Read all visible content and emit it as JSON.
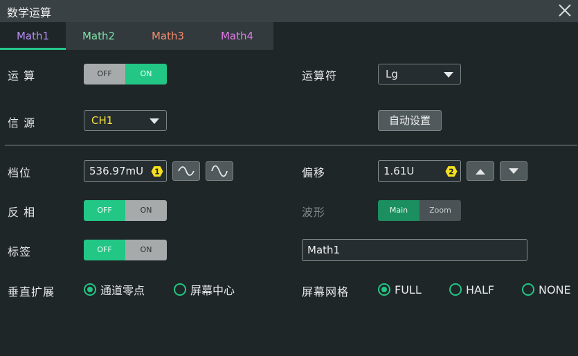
{
  "window": {
    "title": "数学运算"
  },
  "tabs": [
    {
      "label": "Math1",
      "color": "#b58cf2"
    },
    {
      "label": "Math2",
      "color": "#7ee0a8"
    },
    {
      "label": "Math3",
      "color": "#f28a6c"
    },
    {
      "label": "Math4",
      "color": "#e27ae6"
    }
  ],
  "operation": {
    "label": "运 算",
    "off": "OFF",
    "on": "ON",
    "state": "ON"
  },
  "operator": {
    "label": "运算符",
    "value": "Lg"
  },
  "source": {
    "label": "信 源",
    "value": "CH1",
    "value_color": "#f2e23a"
  },
  "auto_setup": {
    "label": "自动设置"
  },
  "scale": {
    "label": "档位",
    "value": "536.97mU",
    "knob": "1"
  },
  "offset": {
    "label": "偏移",
    "value": "1.61U",
    "knob": "2"
  },
  "invert": {
    "label": "反 相",
    "off": "OFF",
    "on": "ON",
    "state": "OFF"
  },
  "waveform": {
    "label": "波形",
    "main": "Main",
    "zoom": "Zoom",
    "state": "Main"
  },
  "tag": {
    "label": "标签",
    "off": "OFF",
    "on": "ON",
    "state": "OFF",
    "text": "Math1"
  },
  "vertical_expand": {
    "label": "垂直扩展",
    "options": [
      "通道零点",
      "屏幕中心"
    ],
    "selected": "通道零点"
  },
  "grid": {
    "label": "屏幕网格",
    "options": [
      "FULL",
      "HALF",
      "NONE"
    ],
    "selected": "FULL"
  },
  "colors": {
    "accent": "#22c786",
    "knob": "#f5e020"
  }
}
